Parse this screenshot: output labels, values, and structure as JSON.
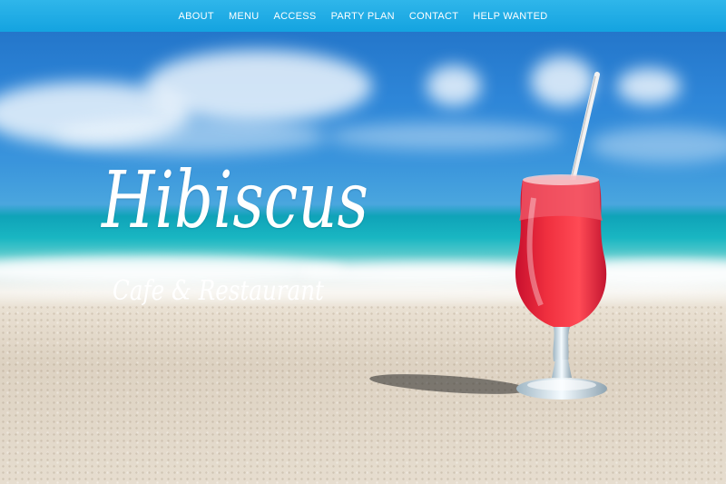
{
  "nav": {
    "items": [
      {
        "label": "ABOUT"
      },
      {
        "label": "MENU"
      },
      {
        "label": "ACCESS"
      },
      {
        "label": "PARTY PLAN"
      },
      {
        "label": "CONTACT"
      },
      {
        "label": "HELP WANTED"
      }
    ]
  },
  "hero": {
    "title": "Hibiscus",
    "subtitle": "Cafe & Restaurant"
  },
  "colors": {
    "nav_bar": "#14a3e0",
    "drink_red": "#e8243a",
    "sea": "#19b6c2",
    "sky": "#2e86d8",
    "sand": "#e6ddcf"
  }
}
